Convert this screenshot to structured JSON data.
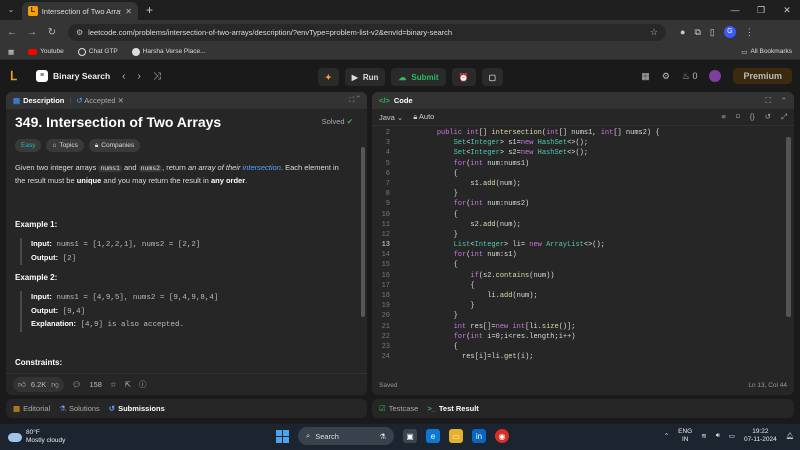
{
  "browser": {
    "tab_title": "Intersection of Two Arrays - Lee",
    "tab_favicon": "L",
    "url": "leetcode.com/problems/intersection-of-two-arrays/description/?envType=problem-list-v2&envId=binary-search",
    "bookmarks": [
      "Youtube",
      "Chat GTP",
      "Harsha Verse Place..."
    ],
    "all_bookmarks": "All Bookmarks",
    "profile_initial": "G"
  },
  "header": {
    "problem_list": "Binary Search",
    "run_label": "Run",
    "submit_label": "Submit",
    "streak_count": "0",
    "premium_label": "Premium"
  },
  "description": {
    "tab_label": "Description",
    "accepted_label": "Accepted",
    "title": "349. Intersection of Two Arrays",
    "solved_label": "Solved",
    "tags": [
      "Easy",
      "Topics",
      "Companies"
    ],
    "text": {
      "p1": "Given two integer arrays ",
      "c1": "nums1",
      "p2": " and ",
      "c2": "nums2",
      "p3": ", return ",
      "em1": "an array of their ",
      "link": "intersection",
      "p4": ". Each element in the result must be ",
      "b1": "unique",
      "p5": " and you may return the result in ",
      "b2": "any order",
      "p6": "."
    },
    "example1": {
      "title": "Example 1:",
      "input_label": "Input:",
      "input_val": " nums1 = [1,2,2,1], nums2 = [2,2]",
      "output_label": "Output:",
      "output_val": " [2]"
    },
    "example2": {
      "title": "Example 2:",
      "input_label": "Input:",
      "input_val": " nums1 = [4,9,5], nums2 = [9,4,9,8,4]",
      "output_label": "Output:",
      "output_val": " [9,4]",
      "expl_label": "Explanation:",
      "expl_val": " [4,9] is also accepted."
    },
    "constraints_title": "Constraints:",
    "likes": "6.2K",
    "comments": "158"
  },
  "bottom_left_tabs": [
    "Editorial",
    "Solutions",
    "Submissions"
  ],
  "code": {
    "panel_label": "Code",
    "language": "Java",
    "auto_label": "Auto",
    "lines": [
      {
        "n": "2",
        "t": "    public int[] intersection(int[] nums1, int[] nums2) {"
      },
      {
        "n": "3",
        "t": "        Set<Integer> s1=new HashSet<>();"
      },
      {
        "n": "4",
        "t": "        Set<Integer> s2=new HashSet<>();"
      },
      {
        "n": "5",
        "t": "        for(int num:nums1)"
      },
      {
        "n": "6",
        "t": "        {"
      },
      {
        "n": "7",
        "t": "            s1.add(num);"
      },
      {
        "n": "8",
        "t": "        }"
      },
      {
        "n": "9",
        "t": "        for(int num:nums2)"
      },
      {
        "n": "10",
        "t": "        {"
      },
      {
        "n": "11",
        "t": "            s2.add(num);"
      },
      {
        "n": "12",
        "t": "        }"
      },
      {
        "n": "13",
        "t": "        List<Integer> li= new ArrayList<>();"
      },
      {
        "n": "14",
        "t": "        for(int num:s1)"
      },
      {
        "n": "15",
        "t": "        {"
      },
      {
        "n": "16",
        "t": "            if(s2.contains(num))"
      },
      {
        "n": "17",
        "t": "            {"
      },
      {
        "n": "18",
        "t": "                li.add(num);"
      },
      {
        "n": "19",
        "t": "            }"
      },
      {
        "n": "20",
        "t": "        }"
      },
      {
        "n": "21",
        "t": "        int res[]=new int[li.size()];"
      },
      {
        "n": "22",
        "t": "        for(int i=0;i<res.length;i++)"
      },
      {
        "n": "23",
        "t": "        {"
      },
      {
        "n": "24",
        "t": "          res[i]=li.get(i);"
      }
    ],
    "current_line": "13",
    "saved_label": "Saved",
    "cursor_pos": "Ln 13, Col 44"
  },
  "bottom_right_tabs": [
    "Testcase",
    "Test Result"
  ],
  "taskbar": {
    "temp": "80°F",
    "weather": "Mostly cloudy",
    "search_label": "Search",
    "lang1": "ENG",
    "lang2": "IN",
    "time": "19:22",
    "date": "07-11-2024"
  }
}
